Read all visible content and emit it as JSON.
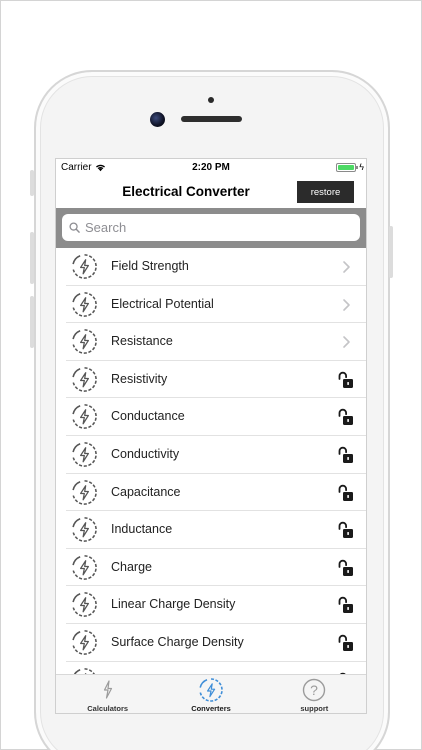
{
  "status_bar": {
    "carrier": "Carrier",
    "time": "2:20 PM",
    "battery_level": 1.0
  },
  "nav": {
    "title": "Electrical Converter",
    "restore_label": "restore"
  },
  "search": {
    "placeholder": "Search",
    "value": ""
  },
  "list": {
    "items": [
      {
        "label": "Field Strength",
        "accessory": "chevron-right-icon"
      },
      {
        "label": "Electrical Potential",
        "accessory": "chevron-right-icon"
      },
      {
        "label": "Resistance",
        "accessory": "chevron-right-icon"
      },
      {
        "label": "Resistivity",
        "accessory": "unlock-icon"
      },
      {
        "label": "Conductance",
        "accessory": "unlock-icon"
      },
      {
        "label": "Conductivity",
        "accessory": "unlock-icon"
      },
      {
        "label": "Capacitance",
        "accessory": "unlock-icon"
      },
      {
        "label": "Inductance",
        "accessory": "unlock-icon"
      },
      {
        "label": "Charge",
        "accessory": "unlock-icon"
      },
      {
        "label": "Linear Charge Density",
        "accessory": "unlock-icon"
      },
      {
        "label": "Surface Charge Density",
        "accessory": "unlock-icon"
      }
    ],
    "item_icon": "bolt-circle-icon"
  },
  "tabbar": {
    "tabs": [
      {
        "label": "Calculators",
        "icon": "bolt-icon",
        "active": false
      },
      {
        "label": "Converters",
        "icon": "bolt-circle-icon",
        "active": true
      },
      {
        "label": "support",
        "icon": "question-circle-icon",
        "active": false
      }
    ]
  },
  "colors": {
    "active_tab": "#3f8ed8",
    "search_bar_bg": "#8c8c8c",
    "restore_bg": "#2b2b2b",
    "battery": "#4cd964"
  }
}
